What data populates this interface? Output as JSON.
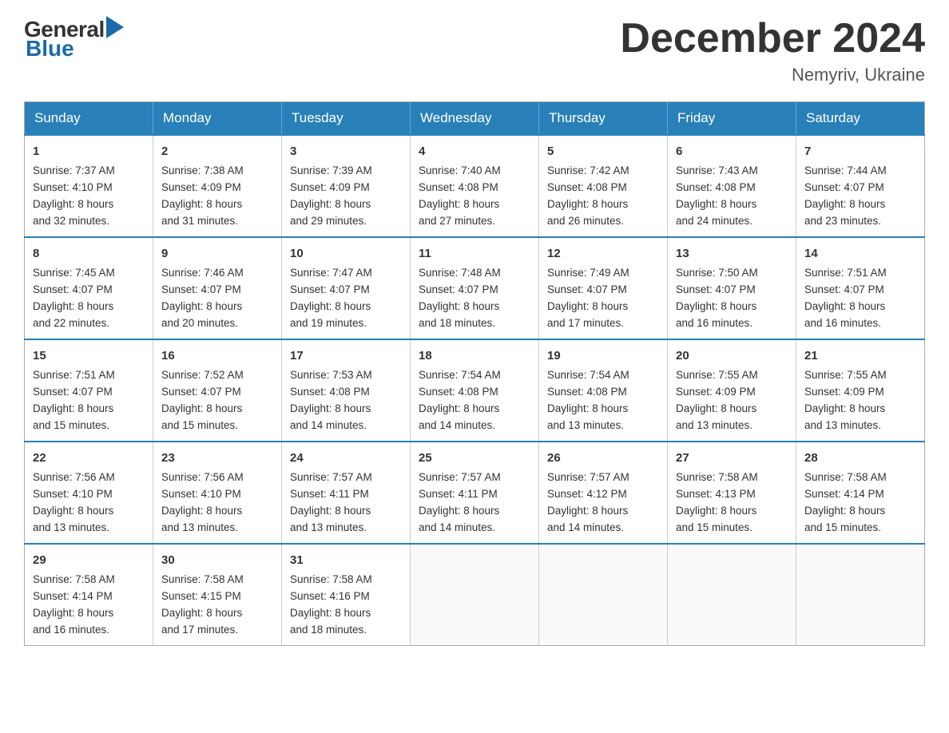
{
  "header": {
    "logo_general": "General",
    "logo_blue": "Blue",
    "month_title": "December 2024",
    "location": "Nemyriv, Ukraine"
  },
  "weekdays": [
    "Sunday",
    "Monday",
    "Tuesday",
    "Wednesday",
    "Thursday",
    "Friday",
    "Saturday"
  ],
  "weeks": [
    [
      {
        "day": "1",
        "sunrise": "7:37 AM",
        "sunset": "4:10 PM",
        "daylight": "8 hours and 32 minutes."
      },
      {
        "day": "2",
        "sunrise": "7:38 AM",
        "sunset": "4:09 PM",
        "daylight": "8 hours and 31 minutes."
      },
      {
        "day": "3",
        "sunrise": "7:39 AM",
        "sunset": "4:09 PM",
        "daylight": "8 hours and 29 minutes."
      },
      {
        "day": "4",
        "sunrise": "7:40 AM",
        "sunset": "4:08 PM",
        "daylight": "8 hours and 27 minutes."
      },
      {
        "day": "5",
        "sunrise": "7:42 AM",
        "sunset": "4:08 PM",
        "daylight": "8 hours and 26 minutes."
      },
      {
        "day": "6",
        "sunrise": "7:43 AM",
        "sunset": "4:08 PM",
        "daylight": "8 hours and 24 minutes."
      },
      {
        "day": "7",
        "sunrise": "7:44 AM",
        "sunset": "4:07 PM",
        "daylight": "8 hours and 23 minutes."
      }
    ],
    [
      {
        "day": "8",
        "sunrise": "7:45 AM",
        "sunset": "4:07 PM",
        "daylight": "8 hours and 22 minutes."
      },
      {
        "day": "9",
        "sunrise": "7:46 AM",
        "sunset": "4:07 PM",
        "daylight": "8 hours and 20 minutes."
      },
      {
        "day": "10",
        "sunrise": "7:47 AM",
        "sunset": "4:07 PM",
        "daylight": "8 hours and 19 minutes."
      },
      {
        "day": "11",
        "sunrise": "7:48 AM",
        "sunset": "4:07 PM",
        "daylight": "8 hours and 18 minutes."
      },
      {
        "day": "12",
        "sunrise": "7:49 AM",
        "sunset": "4:07 PM",
        "daylight": "8 hours and 17 minutes."
      },
      {
        "day": "13",
        "sunrise": "7:50 AM",
        "sunset": "4:07 PM",
        "daylight": "8 hours and 16 minutes."
      },
      {
        "day": "14",
        "sunrise": "7:51 AM",
        "sunset": "4:07 PM",
        "daylight": "8 hours and 16 minutes."
      }
    ],
    [
      {
        "day": "15",
        "sunrise": "7:51 AM",
        "sunset": "4:07 PM",
        "daylight": "8 hours and 15 minutes."
      },
      {
        "day": "16",
        "sunrise": "7:52 AM",
        "sunset": "4:07 PM",
        "daylight": "8 hours and 15 minutes."
      },
      {
        "day": "17",
        "sunrise": "7:53 AM",
        "sunset": "4:08 PM",
        "daylight": "8 hours and 14 minutes."
      },
      {
        "day": "18",
        "sunrise": "7:54 AM",
        "sunset": "4:08 PM",
        "daylight": "8 hours and 14 minutes."
      },
      {
        "day": "19",
        "sunrise": "7:54 AM",
        "sunset": "4:08 PM",
        "daylight": "8 hours and 13 minutes."
      },
      {
        "day": "20",
        "sunrise": "7:55 AM",
        "sunset": "4:09 PM",
        "daylight": "8 hours and 13 minutes."
      },
      {
        "day": "21",
        "sunrise": "7:55 AM",
        "sunset": "4:09 PM",
        "daylight": "8 hours and 13 minutes."
      }
    ],
    [
      {
        "day": "22",
        "sunrise": "7:56 AM",
        "sunset": "4:10 PM",
        "daylight": "8 hours and 13 minutes."
      },
      {
        "day": "23",
        "sunrise": "7:56 AM",
        "sunset": "4:10 PM",
        "daylight": "8 hours and 13 minutes."
      },
      {
        "day": "24",
        "sunrise": "7:57 AM",
        "sunset": "4:11 PM",
        "daylight": "8 hours and 13 minutes."
      },
      {
        "day": "25",
        "sunrise": "7:57 AM",
        "sunset": "4:11 PM",
        "daylight": "8 hours and 14 minutes."
      },
      {
        "day": "26",
        "sunrise": "7:57 AM",
        "sunset": "4:12 PM",
        "daylight": "8 hours and 14 minutes."
      },
      {
        "day": "27",
        "sunrise": "7:58 AM",
        "sunset": "4:13 PM",
        "daylight": "8 hours and 15 minutes."
      },
      {
        "day": "28",
        "sunrise": "7:58 AM",
        "sunset": "4:14 PM",
        "daylight": "8 hours and 15 minutes."
      }
    ],
    [
      {
        "day": "29",
        "sunrise": "7:58 AM",
        "sunset": "4:14 PM",
        "daylight": "8 hours and 16 minutes."
      },
      {
        "day": "30",
        "sunrise": "7:58 AM",
        "sunset": "4:15 PM",
        "daylight": "8 hours and 17 minutes."
      },
      {
        "day": "31",
        "sunrise": "7:58 AM",
        "sunset": "4:16 PM",
        "daylight": "8 hours and 18 minutes."
      },
      null,
      null,
      null,
      null
    ]
  ],
  "labels": {
    "sunrise": "Sunrise:",
    "sunset": "Sunset:",
    "daylight": "Daylight:"
  }
}
